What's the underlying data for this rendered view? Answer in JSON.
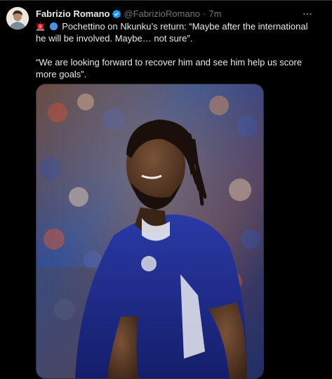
{
  "tweet": {
    "author_name": "Fabrizio Romano",
    "author_handle": "@FabrizioRomano",
    "separator": "·",
    "timestamp": "7m",
    "more_icon": "more-horizontal-icon",
    "verified_icon": "verified-badge-icon",
    "emoji_1": "siren-emoji",
    "emoji_2": "blue-circle-emoji",
    "line_1": "Pochettino on Nkunku’s return: “Maybe after the international he will be involved. Maybe… not sure”.",
    "line_2": "“We are looking forward to recover him and see him help us score more goals”."
  },
  "colors": {
    "background": "#000000",
    "text_primary": "#e7e9ea",
    "text_secondary": "#71767b",
    "verified": "#1d9bf0",
    "jersey": "#1e2a8a"
  }
}
